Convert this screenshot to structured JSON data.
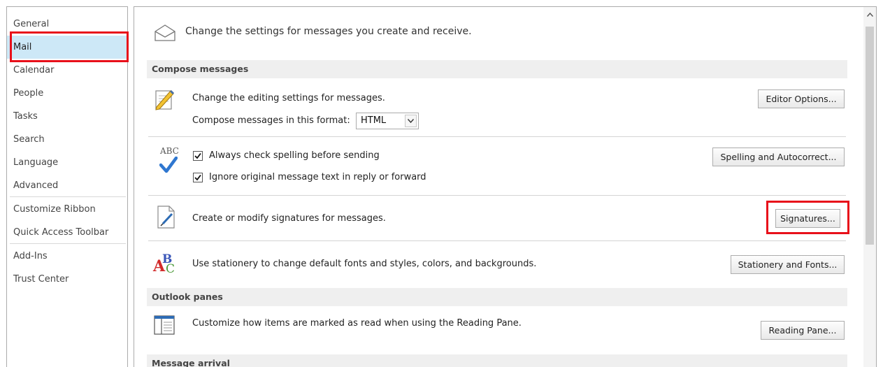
{
  "sidebar": {
    "items": [
      {
        "label": "General"
      },
      {
        "label": "Mail",
        "selected": true
      },
      {
        "label": "Calendar"
      },
      {
        "label": "People"
      },
      {
        "label": "Tasks"
      },
      {
        "label": "Search"
      },
      {
        "label": "Language"
      },
      {
        "label": "Advanced"
      },
      {
        "label": "Customize Ribbon"
      },
      {
        "label": "Quick Access Toolbar"
      },
      {
        "label": "Add-Ins"
      },
      {
        "label": "Trust Center"
      }
    ]
  },
  "header": {
    "text": "Change the settings for messages you create and receive.",
    "icon": "envelope-icon"
  },
  "sections": {
    "compose": "Compose messages",
    "panes": "Outlook panes",
    "arrival": "Message arrival"
  },
  "compose": {
    "editing_text": "Change the editing settings for messages.",
    "format_label": "Compose messages in this format:",
    "format_value": "HTML",
    "editor_button": "Editor Options...",
    "spelling_check_label": "Always check spelling before sending",
    "spelling_check_checked": true,
    "ignore_original_label": "Ignore original message text in reply or forward",
    "ignore_original_checked": true,
    "spelling_button": "Spelling and Autocorrect...",
    "signatures_text": "Create or modify signatures for messages.",
    "signatures_button": "Signatures...",
    "stationery_text": "Use stationery to change default fonts and styles, colors, and backgrounds.",
    "stationery_button": "Stationery and Fonts..."
  },
  "panes": {
    "reading_text": "Customize how items are marked as read when using the Reading Pane.",
    "reading_button": "Reading Pane..."
  },
  "icons": {
    "abc_glyph": "ABC"
  },
  "colors": {
    "selected_bg": "#cde8f7",
    "highlight_red": "#e8101a",
    "section_bg": "#efefef"
  }
}
